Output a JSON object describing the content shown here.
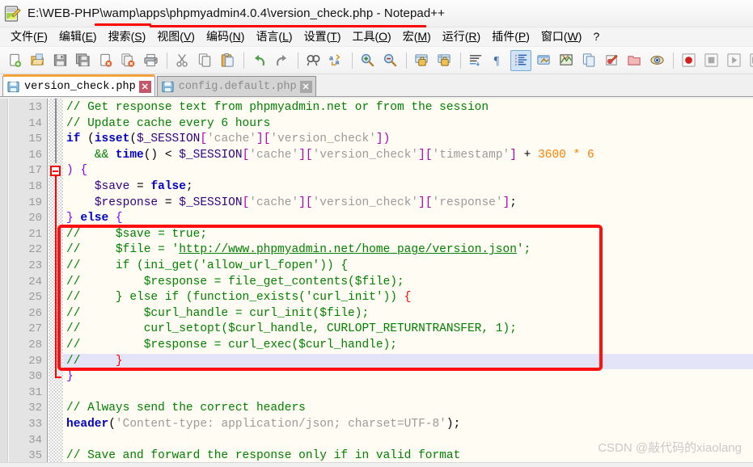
{
  "window": {
    "title": "E:\\WEB-PHP\\wamp\\apps\\phpmyadmin4.0.4\\version_check.php - Notepad++",
    "app_icon": "notepad-plus-plus-icon"
  },
  "menubar": {
    "items": [
      {
        "label": "文件(F)",
        "mnemonic": "F"
      },
      {
        "label": "编辑(E)",
        "mnemonic": "E"
      },
      {
        "label": "搜索(S)",
        "mnemonic": "S"
      },
      {
        "label": "视图(V)",
        "mnemonic": "V"
      },
      {
        "label": "编码(N)",
        "mnemonic": "N"
      },
      {
        "label": "语言(L)",
        "mnemonic": "L"
      },
      {
        "label": "设置(T)",
        "mnemonic": "T"
      },
      {
        "label": "工具(O)",
        "mnemonic": "O"
      },
      {
        "label": "宏(M)",
        "mnemonic": "M"
      },
      {
        "label": "运行(R)",
        "mnemonic": "R"
      },
      {
        "label": "插件(P)",
        "mnemonic": "P"
      },
      {
        "label": "窗口(W)",
        "mnemonic": "W"
      },
      {
        "label": "?",
        "mnemonic": ""
      }
    ]
  },
  "toolbar": {
    "buttons": [
      {
        "name": "new-file-icon",
        "group": 0
      },
      {
        "name": "open-file-icon",
        "group": 0
      },
      {
        "name": "save-icon",
        "group": 0
      },
      {
        "name": "save-all-icon",
        "group": 0
      },
      {
        "name": "close-file-icon",
        "group": 0
      },
      {
        "name": "close-all-files-icon",
        "group": 0
      },
      {
        "name": "print-icon",
        "group": 0
      },
      {
        "name": "cut-icon",
        "group": 1
      },
      {
        "name": "copy-icon",
        "group": 1
      },
      {
        "name": "paste-icon",
        "group": 1
      },
      {
        "name": "undo-icon",
        "group": 2
      },
      {
        "name": "redo-icon",
        "group": 2
      },
      {
        "name": "find-icon",
        "group": 3
      },
      {
        "name": "replace-icon",
        "group": 3
      },
      {
        "name": "zoom-in-icon",
        "group": 4
      },
      {
        "name": "zoom-out-icon",
        "group": 4
      },
      {
        "name": "sync-vertical-scroll-icon",
        "group": 5
      },
      {
        "name": "sync-horizontal-scroll-icon",
        "group": 5
      },
      {
        "name": "word-wrap-icon",
        "group": 6
      },
      {
        "name": "show-all-characters-icon",
        "group": 6
      },
      {
        "name": "indent-guide-icon",
        "group": 6,
        "active": true
      },
      {
        "name": "user-defined-dialog-icon",
        "group": 6
      },
      {
        "name": "document-map-icon",
        "group": 6
      },
      {
        "name": "function-list-icon",
        "group": 6
      },
      {
        "name": "folder-as-workspace-icon",
        "group": 6
      },
      {
        "name": "open-folder-icon",
        "group": 6
      },
      {
        "name": "preview-icon",
        "group": 6
      },
      {
        "name": "record-macro-icon",
        "group": 7
      },
      {
        "name": "stop-macro-icon",
        "group": 7
      },
      {
        "name": "play-macro-icon",
        "group": 7
      },
      {
        "name": "run-macro-multiple-icon",
        "group": 7
      },
      {
        "name": "save-macro-icon",
        "group": 7
      }
    ]
  },
  "tabs": [
    {
      "label": "version_check.php",
      "active": true,
      "close_label": "✕"
    },
    {
      "label": "config.default.php",
      "active": false,
      "close_label": "✕"
    }
  ],
  "editor": {
    "current_line": 29,
    "first_line": 13,
    "fold_marker_line": 17,
    "lines": [
      {
        "n": 13,
        "tokens": [
          {
            "t": "// Get response text from phpmyadmin.net or from the session",
            "c": "t-com"
          }
        ]
      },
      {
        "n": 14,
        "tokens": [
          {
            "t": "// Update cache every 6 hours",
            "c": "t-com"
          }
        ]
      },
      {
        "n": 15,
        "tokens": [
          {
            "t": "if",
            "c": "t-kw"
          },
          {
            "t": " (",
            "c": "t-plain"
          },
          {
            "t": "isset",
            "c": "t-fn"
          },
          {
            "t": "(",
            "c": "t-plain"
          },
          {
            "t": "$_SESSION",
            "c": "t-var"
          },
          {
            "t": "[",
            "c": "t-brk"
          },
          {
            "t": "'cache'",
            "c": "t-str"
          },
          {
            "t": "]",
            "c": "t-brk"
          },
          {
            "t": "[",
            "c": "t-brk"
          },
          {
            "t": "'version_check'",
            "c": "t-str"
          },
          {
            "t": "]",
            "c": "t-brk"
          },
          {
            "t": ")",
            "c": "t-brk"
          }
        ]
      },
      {
        "n": 16,
        "tokens": [
          {
            "t": "    ",
            "c": "t-plain"
          },
          {
            "t": "&&",
            "c": "t-com"
          },
          {
            "t": " ",
            "c": "t-plain"
          },
          {
            "t": "time",
            "c": "t-fn"
          },
          {
            "t": "() ",
            "c": "t-plain"
          },
          {
            "t": "<",
            "c": "t-plain"
          },
          {
            "t": " ",
            "c": "t-plain"
          },
          {
            "t": "$_SESSION",
            "c": "t-var"
          },
          {
            "t": "[",
            "c": "t-brk"
          },
          {
            "t": "'cache'",
            "c": "t-str"
          },
          {
            "t": "]",
            "c": "t-brk"
          },
          {
            "t": "[",
            "c": "t-brk"
          },
          {
            "t": "'version_check'",
            "c": "t-str"
          },
          {
            "t": "]",
            "c": "t-brk"
          },
          {
            "t": "[",
            "c": "t-brk"
          },
          {
            "t": "'timestamp'",
            "c": "t-str"
          },
          {
            "t": "]",
            "c": "t-brk"
          },
          {
            "t": " + ",
            "c": "t-plain"
          },
          {
            "t": "3600",
            "c": "t-num"
          },
          {
            "t": " ",
            "c": "t-plain"
          },
          {
            "t": "*",
            "c": "t-num"
          },
          {
            "t": " ",
            "c": "t-plain"
          },
          {
            "t": "6",
            "c": "t-num"
          }
        ]
      },
      {
        "n": 17,
        "tokens": [
          {
            "t": ")",
            "c": "t-brace"
          },
          {
            "t": " ",
            "c": "t-plain"
          },
          {
            "t": "{",
            "c": "t-brace"
          }
        ]
      },
      {
        "n": 18,
        "tokens": [
          {
            "t": "    ",
            "c": "t-plain"
          },
          {
            "t": "$save",
            "c": "t-var"
          },
          {
            "t": " = ",
            "c": "t-plain"
          },
          {
            "t": "false",
            "c": "t-kw"
          },
          {
            "t": ";",
            "c": "t-plain"
          }
        ]
      },
      {
        "n": 19,
        "tokens": [
          {
            "t": "    ",
            "c": "t-plain"
          },
          {
            "t": "$response",
            "c": "t-var"
          },
          {
            "t": " = ",
            "c": "t-plain"
          },
          {
            "t": "$_SESSION",
            "c": "t-var"
          },
          {
            "t": "[",
            "c": "t-brk"
          },
          {
            "t": "'cache'",
            "c": "t-str"
          },
          {
            "t": "]",
            "c": "t-brk"
          },
          {
            "t": "[",
            "c": "t-brk"
          },
          {
            "t": "'version_check'",
            "c": "t-str"
          },
          {
            "t": "]",
            "c": "t-brk"
          },
          {
            "t": "[",
            "c": "t-brk"
          },
          {
            "t": "'response'",
            "c": "t-str"
          },
          {
            "t": "]",
            "c": "t-brk"
          },
          {
            "t": ";",
            "c": "t-plain"
          }
        ]
      },
      {
        "n": 20,
        "tokens": [
          {
            "t": "}",
            "c": "t-brace"
          },
          {
            "t": " ",
            "c": "t-plain"
          },
          {
            "t": "else",
            "c": "t-kw"
          },
          {
            "t": " ",
            "c": "t-plain"
          },
          {
            "t": "{",
            "c": "t-brace"
          }
        ]
      },
      {
        "n": 21,
        "tokens": [
          {
            "t": "//     $save = true;",
            "c": "t-com"
          }
        ]
      },
      {
        "n": 22,
        "tokens": [
          {
            "t": "//     $file = '",
            "c": "t-com"
          },
          {
            "t": "http://www.phpmyadmin.net/home_page/version.json",
            "c": "t-url"
          },
          {
            "t": "';",
            "c": "t-com"
          }
        ]
      },
      {
        "n": 23,
        "tokens": [
          {
            "t": "//     if (ini_get('allow_url_fopen')) {",
            "c": "t-com"
          }
        ]
      },
      {
        "n": 24,
        "tokens": [
          {
            "t": "//         $response = file_get_contents($file);",
            "c": "t-com"
          }
        ]
      },
      {
        "n": 25,
        "tokens": [
          {
            "t": "//     } else if (function_exists('curl_init')) ",
            "c": "t-com"
          },
          {
            "t": "{",
            "c": "t-rbrace"
          }
        ]
      },
      {
        "n": 26,
        "tokens": [
          {
            "t": "//         $curl_handle = curl_init($file);",
            "c": "t-com"
          }
        ]
      },
      {
        "n": 27,
        "tokens": [
          {
            "t": "//         curl_setopt($curl_handle, CURLOPT_RETURNTRANSFER, 1);",
            "c": "t-com"
          }
        ]
      },
      {
        "n": 28,
        "tokens": [
          {
            "t": "//         $response = curl_exec($curl_handle);",
            "c": "t-com"
          }
        ]
      },
      {
        "n": 29,
        "tokens": [
          {
            "t": "//     ",
            "c": "t-com"
          },
          {
            "t": "}",
            "c": "t-rbrace"
          }
        ]
      },
      {
        "n": 30,
        "tokens": [
          {
            "t": "}",
            "c": "t-brace"
          }
        ]
      },
      {
        "n": 31,
        "tokens": []
      },
      {
        "n": 32,
        "tokens": [
          {
            "t": "// Always send the correct headers",
            "c": "t-com"
          }
        ]
      },
      {
        "n": 33,
        "tokens": [
          {
            "t": "header",
            "c": "t-fn"
          },
          {
            "t": "(",
            "c": "t-plain"
          },
          {
            "t": "'Content-type: application/json; charset=UTF-8'",
            "c": "t-str"
          },
          {
            "t": ")",
            "c": "t-plain"
          },
          {
            "t": ";",
            "c": "t-plain"
          }
        ]
      },
      {
        "n": 34,
        "tokens": []
      },
      {
        "n": 35,
        "tokens": [
          {
            "t": "// Save and forward the response only if in valid format",
            "c": "t-com"
          }
        ]
      }
    ]
  },
  "annotation": {
    "type": "red-rectangle-highlight",
    "covers_lines": "21-29",
    "color": "#fe1010"
  },
  "watermark": {
    "text": "CSDN @敲代码的xiaolang"
  }
}
